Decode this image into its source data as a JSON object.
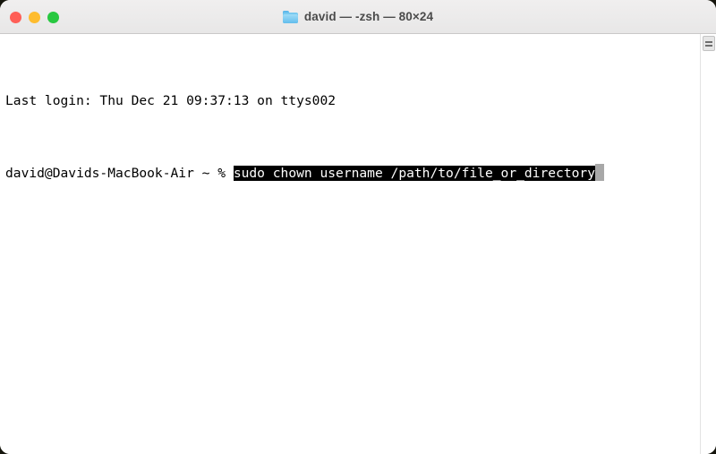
{
  "window": {
    "title": "david — -zsh — 80×24",
    "folder_icon": "folder-icon",
    "traffic_lights": [
      {
        "name": "close",
        "label": "Close",
        "color": "#ff5f57"
      },
      {
        "name": "minimize",
        "label": "Minimize",
        "color": "#febc2e"
      },
      {
        "name": "zoom",
        "label": "Zoom",
        "color": "#28c840"
      }
    ]
  },
  "terminal": {
    "background": "#ffffff",
    "foreground": "#000000",
    "cursor_color": "#a8a8a8",
    "columns": 80,
    "rows": 24,
    "last_login": "Last login: Thu Dec 21 09:37:13 on ttys002",
    "prompt": "david@Davids-MacBook-Air ~ % ",
    "command": "sudo chown username /path/to/file_or_directory",
    "command_selected": true
  },
  "scrollbar": {
    "icon": "scroll-thumb-icon"
  }
}
